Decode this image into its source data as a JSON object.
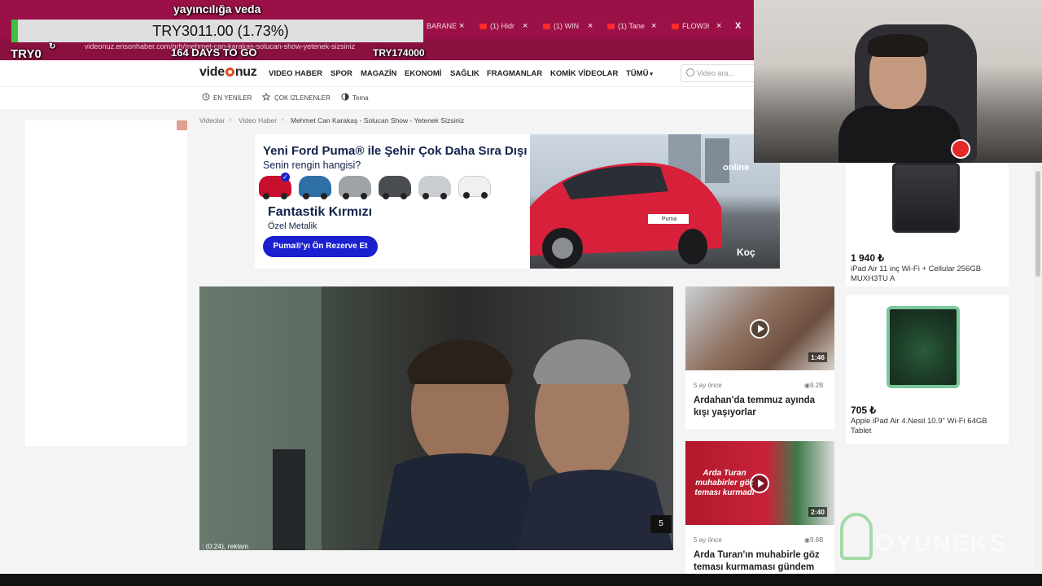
{
  "stream": {
    "title": "yayıncılığa veda",
    "ticker": "TRY3011.00 (1.73%)",
    "left_counter": "TRY0",
    "days_left": "164 DAYS TO GO",
    "goal": "TRY174000",
    "watermark": "OYUNEKS",
    "ticker_color": "#3ec23e"
  },
  "browser": {
    "tabs": [
      {
        "label": "BARANE"
      },
      {
        "label": "(1) Hidr"
      },
      {
        "label": "(1) WIN"
      },
      {
        "label": "(1) Tane"
      },
      {
        "label": "FLOW36"
      },
      {
        "label": "X"
      }
    ],
    "url": "videonuz.ensonhaber.com/qrh/mehmet-can-karakas-solucan-show-yetenek-sizsiniz"
  },
  "site": {
    "logo_left": "vide",
    "logo_right": "nuz",
    "nav": [
      "VIDEO HABER",
      "SPOR",
      "MAGAZİN",
      "EKONOMİ",
      "SAĞLIK",
      "FRAGMANLAR",
      "KOMİK VİDEOLAR",
      "TÜMÜ"
    ],
    "search_placeholder": "Video ara...",
    "subnav": [
      "EN YENİLER",
      "ÇOK İZLENENLER",
      "Tema"
    ],
    "breadcrumb": [
      "Videolar",
      "Video Haber",
      "Mehmet Can Karakaş - Solucan Show - Yetenek Sizsiniz"
    ],
    "accent": "#e84a16"
  },
  "ad": {
    "title": "Yeni Ford Puma® ile Şehir Çok Daha Sıra Dışı",
    "subtitle": "Senin rengin hangisi?",
    "color_name": "Fantastik Kırmızı",
    "finish": "Özel Metalik",
    "cta": "Puma®'yı Ön Rezerve Et",
    "brand": "online",
    "partner": "Koç",
    "plate": "Puma",
    "swatch_colors": [
      "#c8102e",
      "#2f6fa8",
      "#9ea3a8",
      "#4a4d52",
      "#c9ccd0",
      "#eef0f2"
    ]
  },
  "player": {
    "skip_count": "5",
    "ad_timer": ": (0:24), reklam"
  },
  "related": [
    {
      "age": "5 ay önce",
      "views": "9.2B",
      "duration": "1:46",
      "title": "Ardahan'da temmuz ayında kışı yaşıyorlar"
    },
    {
      "age": "5 ay önce",
      "views": "9.8B",
      "duration": "2:40",
      "title": "Arda Turan'ın muhabirle göz teması kurmaması gündem",
      "thumb_text": "Arda Turan muhabirler göz teması kurmadı"
    }
  ],
  "products": [
    {
      "price": "1 940 ₺",
      "name": "iPad Air 11 inç Wi-Fi + Cellular 256GB MUXH3TU A"
    },
    {
      "price": "705 ₺",
      "name": "Apple iPad Air 4.Nesil 10.9\" Wi-Fi 64GB Tablet"
    }
  ]
}
